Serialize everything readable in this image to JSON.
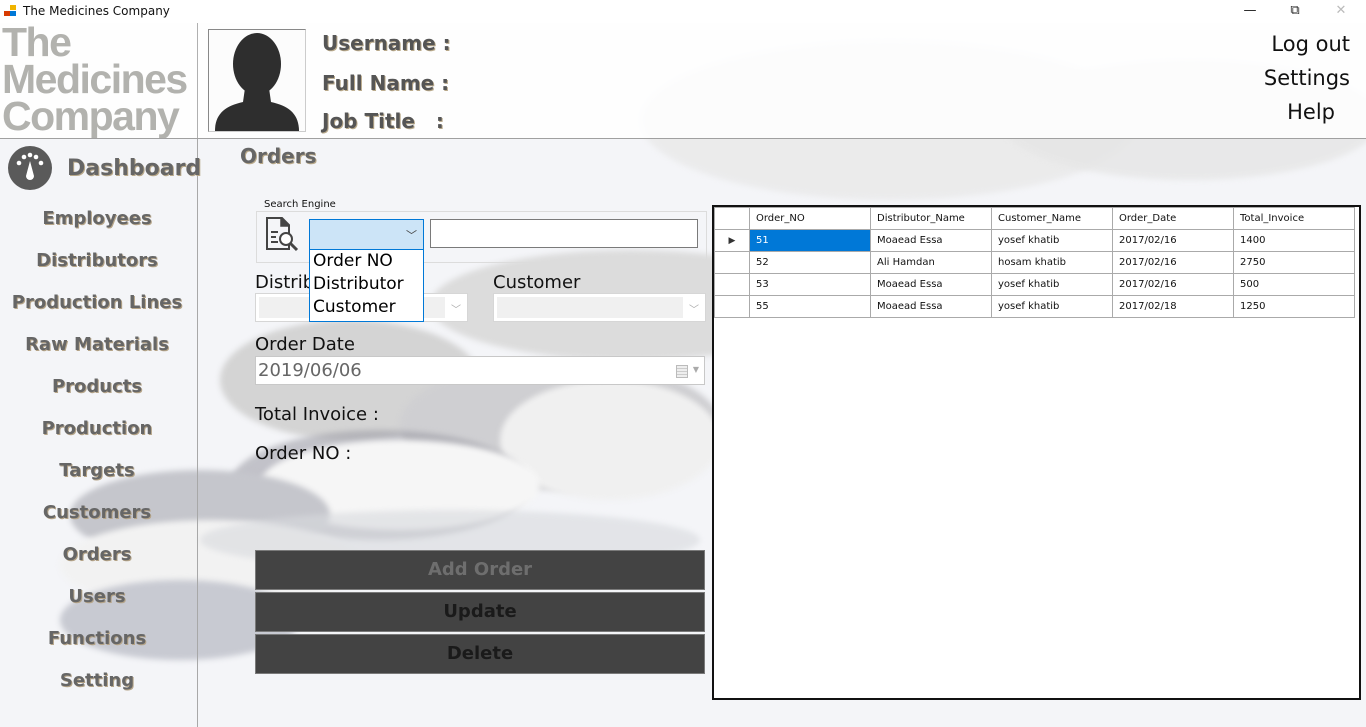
{
  "window": {
    "title": "The Medicines Company",
    "controls": {
      "minimize": "—",
      "restore": "⧉",
      "close": "✕"
    }
  },
  "header": {
    "logo_lines": [
      "The",
      "Medicines",
      "Company"
    ],
    "username_label": "Username :",
    "fullname_label": "Full Name :",
    "jobtitle_label": "Job Title   :",
    "links": {
      "logout": "Log out",
      "settings": "Settings",
      "help": "Help"
    }
  },
  "sidebar": {
    "dashboard": "Dashboard",
    "items": [
      {
        "label": "Employees"
      },
      {
        "label": "Distributors"
      },
      {
        "label": "Production Lines"
      },
      {
        "label": "Raw Materials"
      },
      {
        "label": "Products"
      },
      {
        "label": "Production"
      },
      {
        "label": "Targets"
      },
      {
        "label": "Customers"
      },
      {
        "label": "Orders"
      },
      {
        "label": "Users"
      },
      {
        "label": "Functions"
      },
      {
        "label": "Setting"
      }
    ]
  },
  "main": {
    "title": "Orders",
    "search": {
      "group_label": "Search Engine",
      "combo_value": "",
      "options": [
        "Order NO",
        "Distributor",
        "Customer"
      ],
      "query": ""
    },
    "form": {
      "distributor_label": "Distributor",
      "distributor_value": "",
      "customer_label": "Customer",
      "customer_value": "",
      "order_date_label": "Order Date",
      "order_date_value": "2019/06/06",
      "total_invoice_label": "Total Invoice :",
      "order_no_label": "Order NO :"
    },
    "buttons": {
      "add": "Add Order",
      "update": "Update",
      "delete": "Delete"
    },
    "colors": {
      "button_bg": "#434343",
      "add_text": "#6e6e6e",
      "action_text": "#1a1a1a",
      "selection": "#0078d7",
      "combo_focus": "#cce4f7"
    },
    "grid": {
      "columns": [
        "Order_NO",
        "Distributor_Name",
        "Customer_Name",
        "Order_Date",
        "Total_Invoice"
      ],
      "rows": [
        [
          "51",
          "Moaead Essa",
          "yosef khatib",
          "2017/02/16",
          "1400"
        ],
        [
          "52",
          "Ali Hamdan",
          "hosam khatib",
          "2017/02/16",
          "2750"
        ],
        [
          "53",
          "Moaead Essa",
          "yosef khatib",
          "2017/02/16",
          "500"
        ],
        [
          "55",
          "Moaead Essa",
          "yosef khatib",
          "2017/02/18",
          "1250"
        ]
      ],
      "current_row_indicator": "▶"
    }
  }
}
